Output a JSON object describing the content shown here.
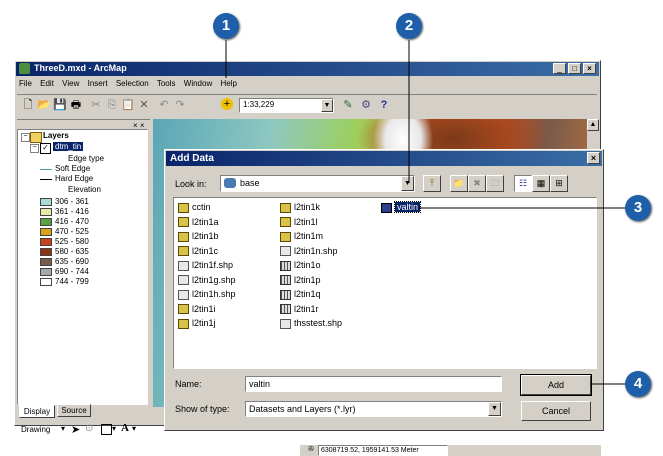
{
  "callouts": [
    "1",
    "2",
    "3",
    "4"
  ],
  "window": {
    "title": "ThreeD.mxd - ArcMap",
    "menu": [
      "File",
      "Edit",
      "View",
      "Insert",
      "Selection",
      "Tools",
      "Window",
      "Help"
    ],
    "scale": "1:33,229",
    "status_coords": "6308719.52, 1959141.53 Meter"
  },
  "toc": {
    "layers_label": "Layers",
    "layer_name": "dtm_tin",
    "edge_type": "Edge type",
    "soft_edge": "Soft Edge",
    "hard_edge": "Hard Edge",
    "elevation": "Elevation",
    "ranges": [
      {
        "label": "306 - 361",
        "color": "#aadbd6"
      },
      {
        "label": "361 - 416",
        "color": "#e8e8a8"
      },
      {
        "label": "416 - 470",
        "color": "#5aa046"
      },
      {
        "label": "470 - 525",
        "color": "#d9a21e"
      },
      {
        "label": "525 - 580",
        "color": "#c8401e"
      },
      {
        "label": "580 - 635",
        "color": "#8a3316"
      },
      {
        "label": "635 - 690",
        "color": "#7a5a4a"
      },
      {
        "label": "690 - 744",
        "color": "#a8a8a8"
      },
      {
        "label": "744 - 799",
        "color": "#ffffff"
      }
    ],
    "tab_display": "Display",
    "tab_source": "Source"
  },
  "drawing_toolbar": {
    "label": "Drawing"
  },
  "dialog": {
    "title": "Add Data",
    "look_in_label": "Look in:",
    "look_in_value": "base",
    "files": [
      {
        "name": "cctin",
        "type": "tin"
      },
      {
        "name": "l2tin1a",
        "type": "tin"
      },
      {
        "name": "l2tin1b",
        "type": "tin"
      },
      {
        "name": "l2tin1c",
        "type": "tin"
      },
      {
        "name": "l2tin1f.shp",
        "type": "shp"
      },
      {
        "name": "l2tin1g.shp",
        "type": "shp"
      },
      {
        "name": "l2tin1h.shp",
        "type": "shp"
      },
      {
        "name": "l2tin1i",
        "type": "tin"
      },
      {
        "name": "l2tin1j",
        "type": "tin"
      },
      {
        "name": "l2tin1k",
        "type": "tin"
      },
      {
        "name": "l2tin1l",
        "type": "tin"
      },
      {
        "name": "l2tin1m",
        "type": "tin"
      },
      {
        "name": "l2tin1n.shp",
        "type": "shp"
      },
      {
        "name": "l2tin1o",
        "type": "grid"
      },
      {
        "name": "l2tin1p",
        "type": "grid"
      },
      {
        "name": "l2tin1q",
        "type": "grid"
      },
      {
        "name": "l2tin1r",
        "type": "grid"
      },
      {
        "name": "thsstest.shp",
        "type": "shp"
      },
      {
        "name": "valtin",
        "type": "sel"
      }
    ],
    "name_label": "Name:",
    "name_value": "valtin",
    "type_label": "Show of type:",
    "type_value": "Datasets and Layers (*.lyr)",
    "add_label": "Add",
    "cancel_label": "Cancel"
  }
}
